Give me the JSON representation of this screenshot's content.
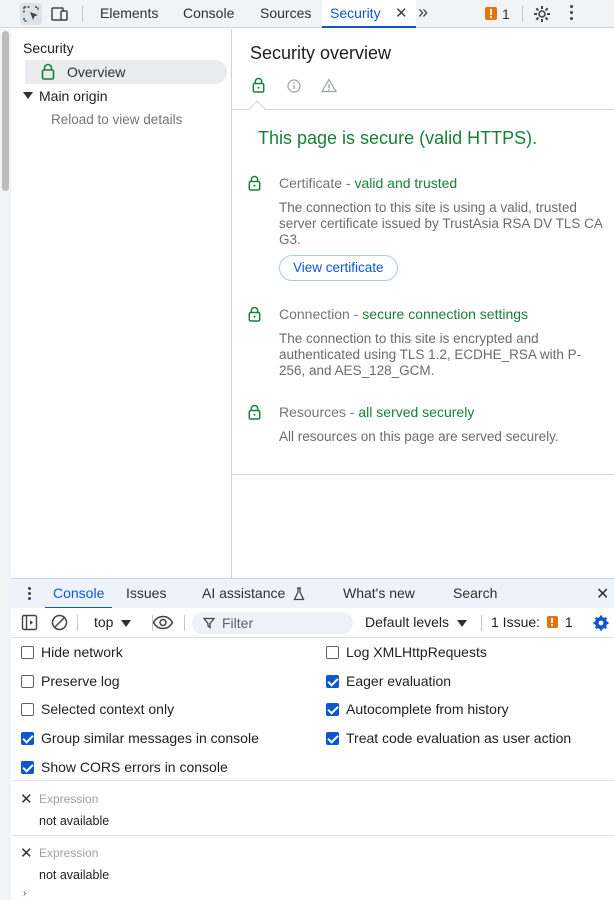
{
  "topbar": {
    "tabs": [
      "Elements",
      "Console",
      "Sources",
      "Security"
    ],
    "active_tab": "Security",
    "issues_count": "1",
    "icons": [
      "inspect-icon",
      "device-toggle-icon",
      "close-icon",
      "more-tabs-icon",
      "issue-flag-icon",
      "gear-icon",
      "kebab-menu-icon"
    ]
  },
  "sidebar": {
    "heading": "Security",
    "overview": "Overview",
    "main_origin": "Main origin",
    "reload_hint": "Reload to view details"
  },
  "main": {
    "title": "Security overview",
    "secure_message": "This page is secure (valid HTTPS).",
    "certificate": {
      "label": "Certificate",
      "dash": " - ",
      "status": "valid and trusted",
      "description": "The connection to this site is using a valid, trusted server certificate issued by TrustAsia RSA DV TLS CA G3.",
      "button": "View certificate"
    },
    "connection": {
      "label": "Connection",
      "dash": " - ",
      "status": "secure connection settings",
      "description": "The connection to this site is encrypted and authenticated using TLS 1.2, ECDHE_RSA with P-256, and AES_128_GCM."
    },
    "resources": {
      "label": "Resources",
      "dash": " - ",
      "status": "all served securely",
      "description": "All resources on this page are served securely."
    }
  },
  "drawer": {
    "tabs": [
      "Console",
      "Issues",
      "AI assistance",
      "What's new",
      "Search"
    ],
    "active_tab": "Console"
  },
  "console_toolbar": {
    "context": "top",
    "filter_placeholder": "Filter",
    "levels": "Default levels",
    "issues_label": "1 Issue:",
    "issues_count": "1"
  },
  "settings": {
    "left": [
      {
        "label": "Hide network",
        "checked": false
      },
      {
        "label": "Preserve log",
        "checked": false
      },
      {
        "label": "Selected context only",
        "checked": false
      },
      {
        "label": "Group similar messages in console",
        "checked": true
      },
      {
        "label": "Show CORS errors in console",
        "checked": true
      }
    ],
    "right": [
      {
        "label": "Log XMLHttpRequests",
        "checked": false
      },
      {
        "label": "Eager evaluation",
        "checked": true
      },
      {
        "label": "Autocomplete from history",
        "checked": true
      },
      {
        "label": "Treat code evaluation as user action",
        "checked": true
      }
    ]
  },
  "expressions": [
    {
      "placeholder": "Expression",
      "value": "not available"
    },
    {
      "placeholder": "Expression",
      "value": "not available"
    }
  ],
  "colors": {
    "accent": "#0b57d0",
    "secure_green": "#188038",
    "issue_orange": "#e8710a"
  }
}
